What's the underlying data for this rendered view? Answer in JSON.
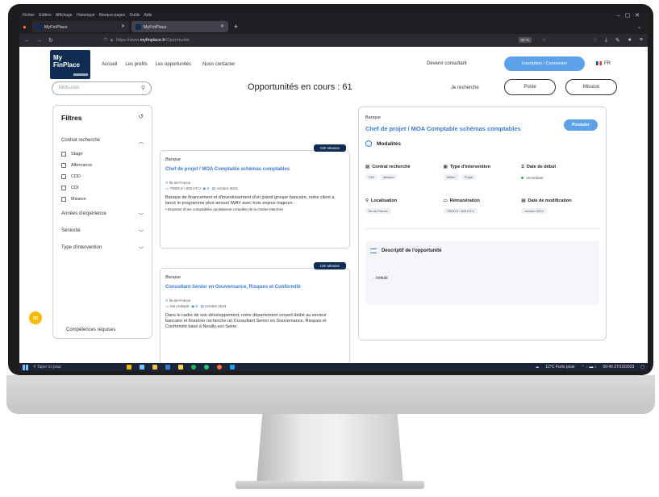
{
  "menubar": {
    "items": [
      "Fichier",
      "Edition",
      "Affichage",
      "Historique",
      "Marque-pages",
      "Outils",
      "Aide"
    ]
  },
  "tabs": [
    {
      "label": "MyFinPlace",
      "active": false
    },
    {
      "label": "MyFinPlace",
      "active": true
    }
  ],
  "address": {
    "prefix": "https://www.",
    "domain": "myfinplace.fr",
    "path": "/Opportunite",
    "zoom": "90 %"
  },
  "nav": {
    "links": [
      "Accueil",
      "Les profils",
      "Les opportunités",
      "Nous contacter"
    ],
    "consultant": "Devenir consultant",
    "cta": "Inscription / Connexion",
    "lang": "FR"
  },
  "logo": {
    "line1": "My",
    "line2": "FinPlace"
  },
  "search": {
    "placeholder": "Mots-clés"
  },
  "heading": "Opportunités en cours : 61",
  "look_for": {
    "label": "Je recherche",
    "options": [
      "Poste",
      "Mission"
    ]
  },
  "filters": {
    "title": "Filtres",
    "contract": "Contrat recherché",
    "contract_options": [
      "Stage",
      "Alternance",
      "CDD",
      "CDI",
      "Mission"
    ],
    "groups": [
      "Années d'expérience",
      "Séniorité",
      "Type d'intervention"
    ],
    "footer": "Compétences requises"
  },
  "cards": [
    {
      "badge": "CDI Mission",
      "category": "Banque",
      "title": "Chef de projet / MOA Comptable schémas comptables",
      "region": "Île-de-France",
      "salary": "70000 € / 800 HT/J",
      "count": "4",
      "date": "octobre 2023",
      "description": "Banque de financement et d'investissement d'un grand groupe bancaire, notre client a lancé le programme pluri-annuel IWAY avec trois enjeux majeurs :",
      "bullet": "• Disposer d'une comptabilité quotidienne complète de la chaîne Marchés"
    },
    {
      "badge": "CDI Mission",
      "category": "Banque",
      "title": "Consultant Senior en Gouvernance, Risques et Conformité",
      "region": "Île-de-France",
      "salary": "Non indiqué",
      "count": "9",
      "date": "octobre 2023",
      "description": "Dans le cadre de son développement, notre département conseil dédié au secteur bancaire et financier recherche un Consultant Senior en Gouvernance, Risques et Conformité basé à Neuilly-sur-Seine.",
      "bullet": ""
    }
  ],
  "detail": {
    "category": "Banque",
    "title": "Chef de projet / MOA Comptable schémas comptables",
    "apply": "Postuler",
    "section": "Modalités",
    "fields": [
      {
        "label": "Contrat recherché",
        "chips": [
          "CDI",
          "Mission"
        ]
      },
      {
        "label": "Type d'intervention",
        "chips": [
          "Métier",
          "Projet"
        ]
      },
      {
        "label": "Date de début",
        "chips": [
          "Immédiate"
        ]
      },
      {
        "label": "Localisation",
        "chips": [
          "Île-de-France"
        ]
      },
      {
        "label": "Rémunération",
        "chips": [
          "70000 € / 800 HT/J"
        ]
      },
      {
        "label": "Date de modification",
        "chips": [
          "octobre 2023"
        ]
      }
    ],
    "desc_title": "Descriptif de l'opportunité",
    "desc_sub": "Intitulé"
  },
  "taskbar": {
    "search": "Taper ici pour",
    "weather": "12°C Forte pluie",
    "time": "00:40",
    "date": "27/10/2023"
  },
  "colors": {
    "navy": "#0f2d52",
    "accent": "#5da2e8",
    "link": "#3a7bd5"
  }
}
